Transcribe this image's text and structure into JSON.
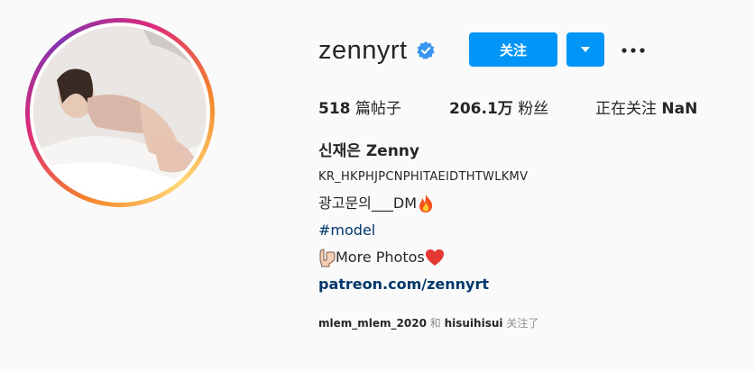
{
  "profile": {
    "username": "zennyrt",
    "follow_label": "关注",
    "posts_count": "518",
    "posts_label": "篇帖子",
    "followers_count": "206.1万",
    "followers_label": "粉丝",
    "following_label": "正在关注",
    "following_count": "NaN"
  },
  "bio": {
    "full_name": "신재은 Zenny",
    "line1": "KR_HKPHJPCNPHITAEIDTHTWLKMV",
    "line2": "광고문의___DM",
    "hashtag": "#model",
    "line4": "More Photos",
    "link": "patreon.com/zennyrt"
  },
  "followed_by": {
    "user1": "mlem_mlem_2020",
    "joiner": "和",
    "user2": "hisuihisui",
    "suffix": "关注了"
  },
  "icons": {
    "verified": "verified-badge-icon",
    "dropdown": "chevron-down-icon",
    "more": "more-options-icon",
    "fire": "fire-emoji-icon",
    "pointing": "pointing-down-emoji-icon",
    "heart": "red-heart-emoji-icon"
  },
  "colors": {
    "primary_button": "#0095f6",
    "link": "#00376b",
    "verified": "#3897f0"
  }
}
